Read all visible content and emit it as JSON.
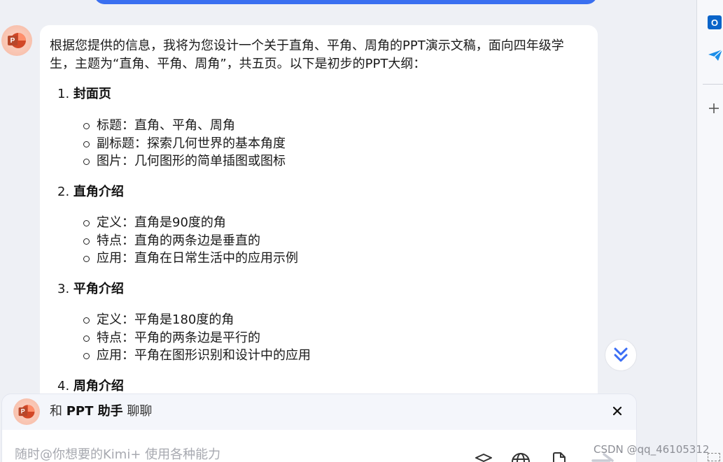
{
  "message": {
    "intro": "根据您提供的信息，我将为您设计一个关于直角、平角、周角的PPT演示文稿，面向四年级学生，主题为“直角、平角、周角”，共五页。以下是初步的PPT大纲：",
    "sections": [
      {
        "num": "1.",
        "title": "封面页",
        "bullets": [
          "标题：直角、平角、周角",
          "副标题：探索几何世界的基本角度",
          "图片：几何图形的简单插图或图标"
        ]
      },
      {
        "num": "2.",
        "title": "直角介绍",
        "bullets": [
          "定义：直角是90度的角",
          "特点：直角的两条边是垂直的",
          "应用：直角在日常生活中的应用示例"
        ]
      },
      {
        "num": "3.",
        "title": "平角介绍",
        "bullets": [
          "定义：平角是180度的角",
          "特点：平角的两条边是平行的",
          "应用：平角在图形识别和设计中的应用"
        ]
      },
      {
        "num": "4.",
        "title": "周角介绍",
        "bullets": []
      }
    ]
  },
  "avatar_letter": "P",
  "composer": {
    "prefix": "和",
    "assistant_name": "PPT 助手",
    "suffix": "聊聊",
    "placeholder": "随时@你想要的Kimi+ 使用各种能力"
  },
  "sidebar": {
    "outlook_letter": "O"
  },
  "watermark": "CSDN @qq_46105312",
  "colors": {
    "accent": "#3a6ff0",
    "avatar_bg": "#f7b9a3",
    "ppt_red": "#d24726",
    "scroll_arrow": "#3b6ef5"
  },
  "icons": {
    "scroll": "double-chevron-down-icon",
    "close": "close-icon",
    "tools": [
      "cube-icon",
      "globe-icon",
      "file-icon",
      "send-arrow-icon"
    ],
    "sidebar": [
      "outlook-icon",
      "send-plane-icon",
      "plus-icon"
    ]
  }
}
